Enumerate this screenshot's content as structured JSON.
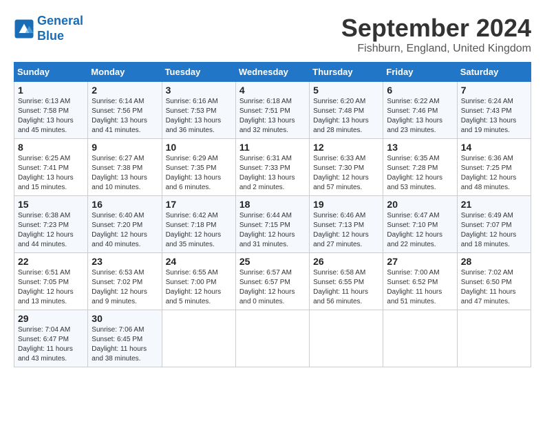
{
  "header": {
    "logo_line1": "General",
    "logo_line2": "Blue",
    "month_title": "September 2024",
    "location": "Fishburn, England, United Kingdom"
  },
  "weekdays": [
    "Sunday",
    "Monday",
    "Tuesday",
    "Wednesday",
    "Thursday",
    "Friday",
    "Saturday"
  ],
  "weeks": [
    [
      {
        "day": "1",
        "info": "Sunrise: 6:13 AM\nSunset: 7:58 PM\nDaylight: 13 hours\nand 45 minutes."
      },
      {
        "day": "2",
        "info": "Sunrise: 6:14 AM\nSunset: 7:56 PM\nDaylight: 13 hours\nand 41 minutes."
      },
      {
        "day": "3",
        "info": "Sunrise: 6:16 AM\nSunset: 7:53 PM\nDaylight: 13 hours\nand 36 minutes."
      },
      {
        "day": "4",
        "info": "Sunrise: 6:18 AM\nSunset: 7:51 PM\nDaylight: 13 hours\nand 32 minutes."
      },
      {
        "day": "5",
        "info": "Sunrise: 6:20 AM\nSunset: 7:48 PM\nDaylight: 13 hours\nand 28 minutes."
      },
      {
        "day": "6",
        "info": "Sunrise: 6:22 AM\nSunset: 7:46 PM\nDaylight: 13 hours\nand 23 minutes."
      },
      {
        "day": "7",
        "info": "Sunrise: 6:24 AM\nSunset: 7:43 PM\nDaylight: 13 hours\nand 19 minutes."
      }
    ],
    [
      {
        "day": "8",
        "info": "Sunrise: 6:25 AM\nSunset: 7:41 PM\nDaylight: 13 hours\nand 15 minutes."
      },
      {
        "day": "9",
        "info": "Sunrise: 6:27 AM\nSunset: 7:38 PM\nDaylight: 13 hours\nand 10 minutes."
      },
      {
        "day": "10",
        "info": "Sunrise: 6:29 AM\nSunset: 7:35 PM\nDaylight: 13 hours\nand 6 minutes."
      },
      {
        "day": "11",
        "info": "Sunrise: 6:31 AM\nSunset: 7:33 PM\nDaylight: 13 hours\nand 2 minutes."
      },
      {
        "day": "12",
        "info": "Sunrise: 6:33 AM\nSunset: 7:30 PM\nDaylight: 12 hours\nand 57 minutes."
      },
      {
        "day": "13",
        "info": "Sunrise: 6:35 AM\nSunset: 7:28 PM\nDaylight: 12 hours\nand 53 minutes."
      },
      {
        "day": "14",
        "info": "Sunrise: 6:36 AM\nSunset: 7:25 PM\nDaylight: 12 hours\nand 48 minutes."
      }
    ],
    [
      {
        "day": "15",
        "info": "Sunrise: 6:38 AM\nSunset: 7:23 PM\nDaylight: 12 hours\nand 44 minutes."
      },
      {
        "day": "16",
        "info": "Sunrise: 6:40 AM\nSunset: 7:20 PM\nDaylight: 12 hours\nand 40 minutes."
      },
      {
        "day": "17",
        "info": "Sunrise: 6:42 AM\nSunset: 7:18 PM\nDaylight: 12 hours\nand 35 minutes."
      },
      {
        "day": "18",
        "info": "Sunrise: 6:44 AM\nSunset: 7:15 PM\nDaylight: 12 hours\nand 31 minutes."
      },
      {
        "day": "19",
        "info": "Sunrise: 6:46 AM\nSunset: 7:13 PM\nDaylight: 12 hours\nand 27 minutes."
      },
      {
        "day": "20",
        "info": "Sunrise: 6:47 AM\nSunset: 7:10 PM\nDaylight: 12 hours\nand 22 minutes."
      },
      {
        "day": "21",
        "info": "Sunrise: 6:49 AM\nSunset: 7:07 PM\nDaylight: 12 hours\nand 18 minutes."
      }
    ],
    [
      {
        "day": "22",
        "info": "Sunrise: 6:51 AM\nSunset: 7:05 PM\nDaylight: 12 hours\nand 13 minutes."
      },
      {
        "day": "23",
        "info": "Sunrise: 6:53 AM\nSunset: 7:02 PM\nDaylight: 12 hours\nand 9 minutes."
      },
      {
        "day": "24",
        "info": "Sunrise: 6:55 AM\nSunset: 7:00 PM\nDaylight: 12 hours\nand 5 minutes."
      },
      {
        "day": "25",
        "info": "Sunrise: 6:57 AM\nSunset: 6:57 PM\nDaylight: 12 hours\nand 0 minutes."
      },
      {
        "day": "26",
        "info": "Sunrise: 6:58 AM\nSunset: 6:55 PM\nDaylight: 11 hours\nand 56 minutes."
      },
      {
        "day": "27",
        "info": "Sunrise: 7:00 AM\nSunset: 6:52 PM\nDaylight: 11 hours\nand 51 minutes."
      },
      {
        "day": "28",
        "info": "Sunrise: 7:02 AM\nSunset: 6:50 PM\nDaylight: 11 hours\nand 47 minutes."
      }
    ],
    [
      {
        "day": "29",
        "info": "Sunrise: 7:04 AM\nSunset: 6:47 PM\nDaylight: 11 hours\nand 43 minutes."
      },
      {
        "day": "30",
        "info": "Sunrise: 7:06 AM\nSunset: 6:45 PM\nDaylight: 11 hours\nand 38 minutes."
      },
      {
        "day": "",
        "info": ""
      },
      {
        "day": "",
        "info": ""
      },
      {
        "day": "",
        "info": ""
      },
      {
        "day": "",
        "info": ""
      },
      {
        "day": "",
        "info": ""
      }
    ]
  ]
}
